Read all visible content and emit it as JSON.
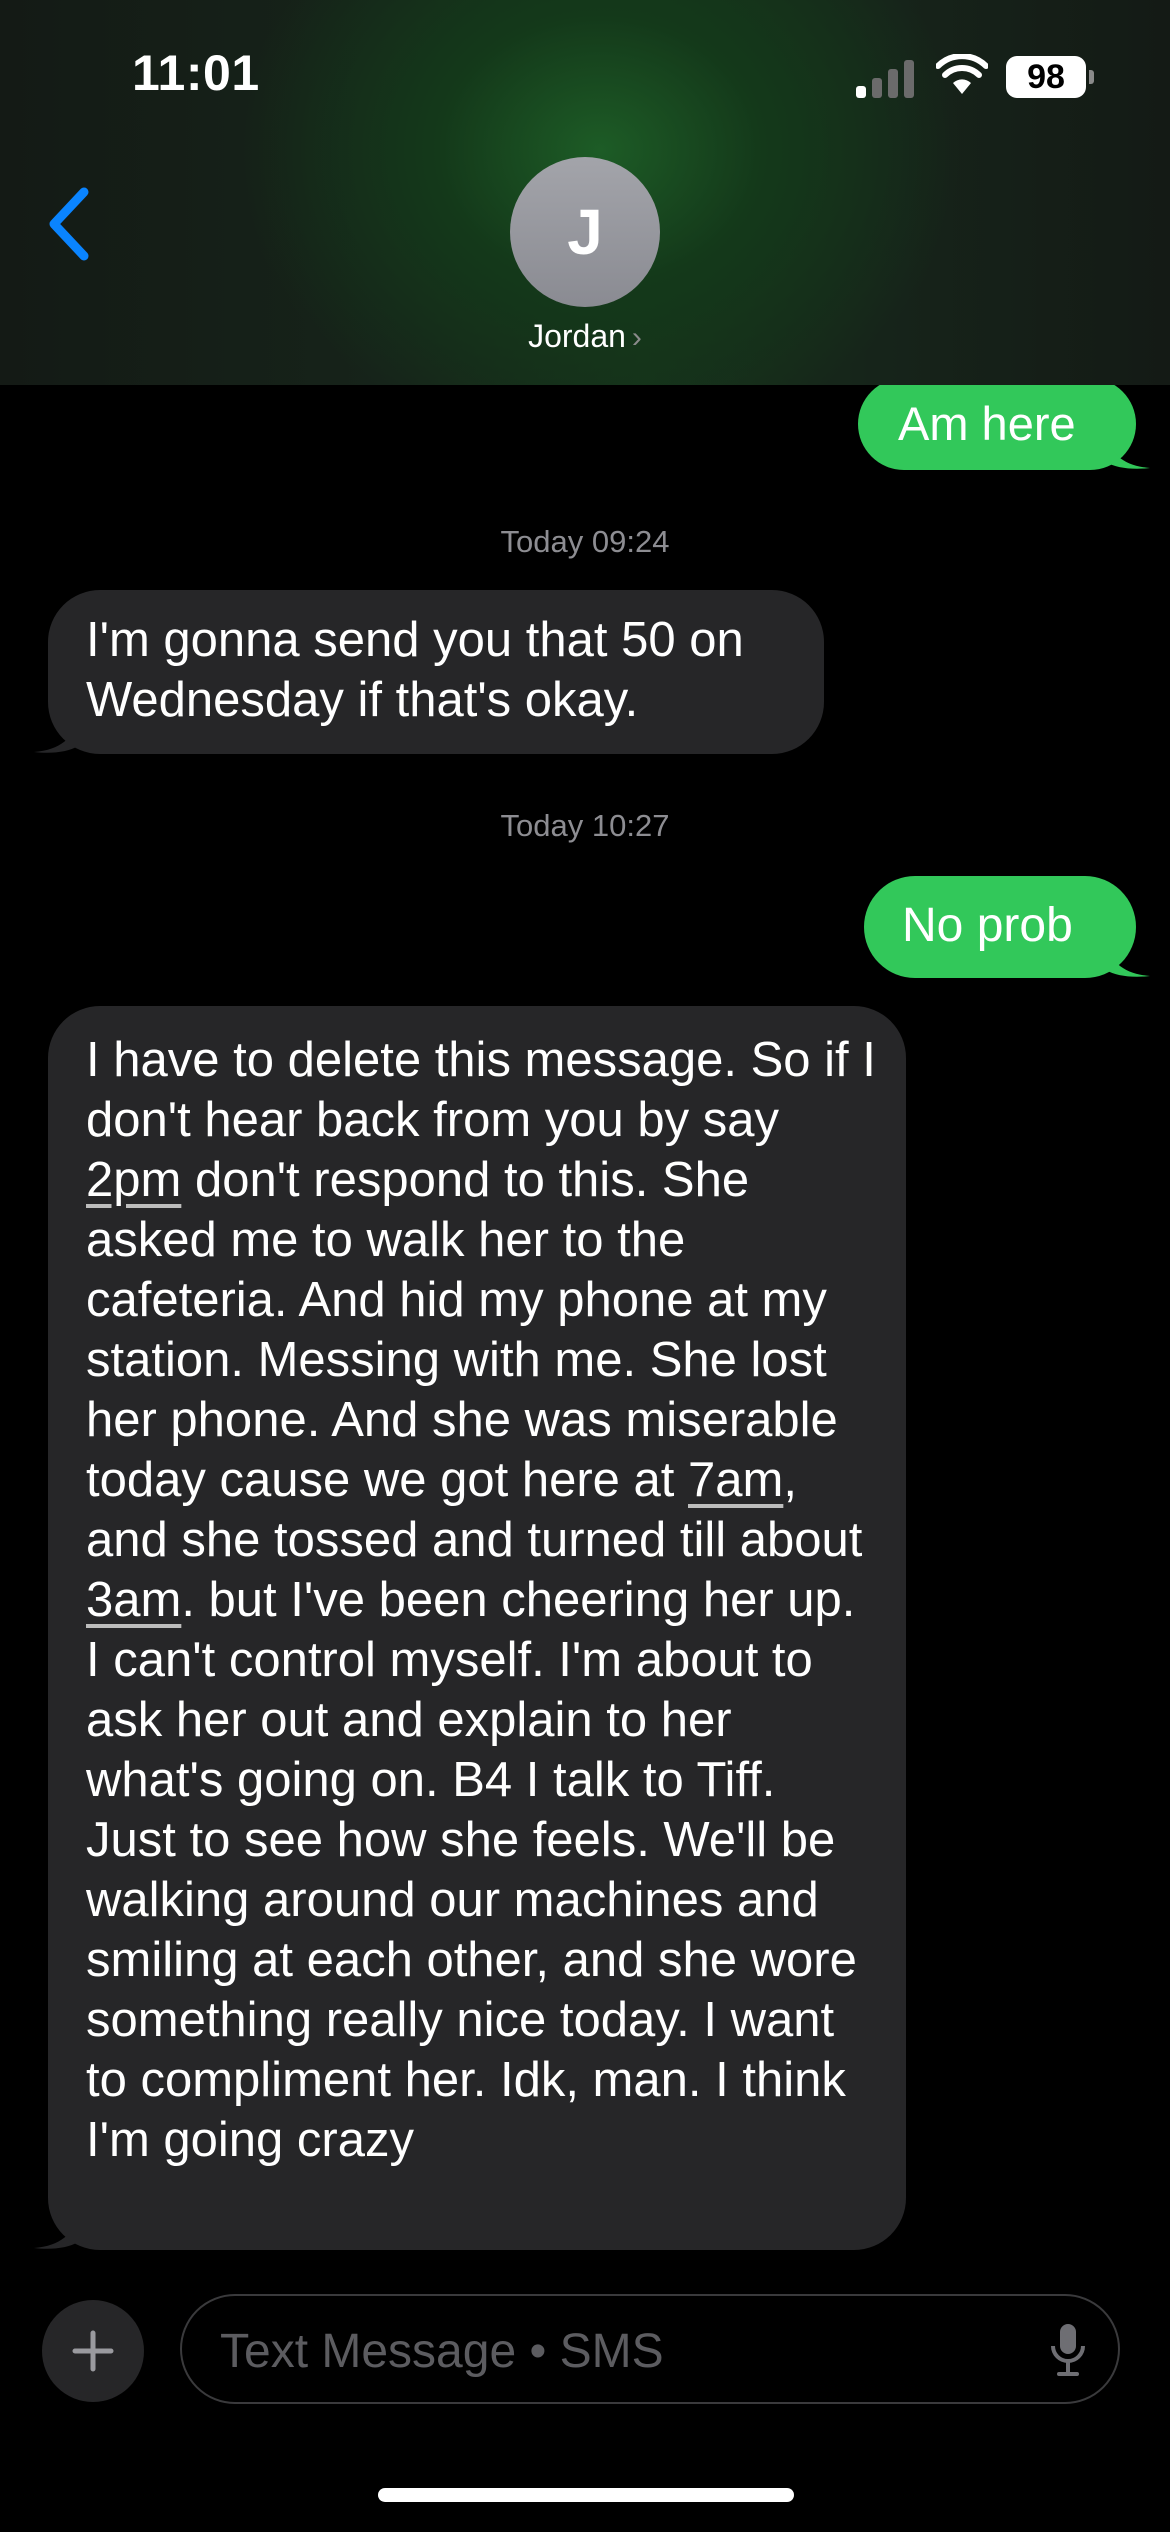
{
  "status_bar": {
    "time": "11:01",
    "battery": "98",
    "icons": [
      "cellular-signal-icon",
      "wifi-icon",
      "battery-icon"
    ]
  },
  "nav": {
    "back_icon": "chevron-left-icon",
    "avatar_initial": "J",
    "contact_name": "Jordan",
    "contact_chevron": "›"
  },
  "colors": {
    "outgoing_bubble": "#32c85a",
    "incoming_bubble": "#262628",
    "accent_blue": "#0a84ff",
    "header_green": "#1d5c26"
  },
  "messages": [
    {
      "type": "outgoing",
      "text": "Am here"
    },
    {
      "type": "timestamp",
      "text": "Today 09:24"
    },
    {
      "type": "incoming",
      "text": "I'm gonna send you that 50 on Wednesday if that's okay."
    },
    {
      "type": "timestamp",
      "text": "Today 10:27"
    },
    {
      "type": "outgoing",
      "text": "No prob"
    },
    {
      "type": "incoming",
      "text": "I have to delete this message. So if I don't hear back from you by say 2pm don't respond to this. She asked me to walk her to the cafeteria. And hid my phone at my station. Messing with me. She lost her phone. And she was miserable today cause we got here at 7am, and she tossed and turned till about 3am. but I've been cheering her up. I can't control myself. I'm about to ask her out and explain to her what's going on. B4 I talk to Tiff. Just to see how she feels. We'll be walking around our machines and smiling at each other, and she wore something really nice today. I want to compliment her. Idk, man. I think I'm going crazy",
      "detected_links": [
        "2pm",
        "7am",
        "3am"
      ]
    }
  ],
  "composer": {
    "plus_icon": "plus-icon",
    "placeholder": "Text Message • SMS",
    "mic_icon": "microphone-icon"
  }
}
